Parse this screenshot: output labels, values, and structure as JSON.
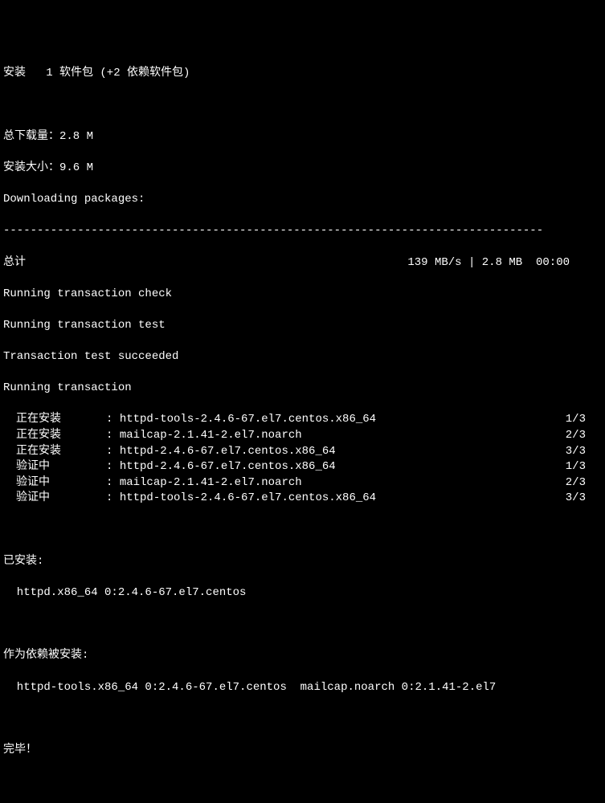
{
  "header": {
    "install_line": "安装   1 软件包 (+2 依赖软件包)"
  },
  "totals": {
    "download_size_label": "总下载量：2.8 M",
    "install_size_label": "安装大小：9.6 M",
    "downloading": "Downloading packages:",
    "separator": "--------------------------------------------------------------------------------",
    "summary_label": "总计",
    "summary_speed_size_time": "139 MB/s | 2.8 MB  00:00"
  },
  "transaction": {
    "check": "Running transaction check",
    "test": "Running transaction test",
    "succeeded": "Transaction test succeeded",
    "running": "Running transaction",
    "steps": [
      {
        "action": "正在安装",
        "colon": ": ",
        "pkg": "httpd-tools-2.4.6-67.el7.centos.x86_64",
        "count": "1/3"
      },
      {
        "action": "正在安装",
        "colon": ": ",
        "pkg": "mailcap-2.1.41-2.el7.noarch",
        "count": "2/3"
      },
      {
        "action": "正在安装",
        "colon": ": ",
        "pkg": "httpd-2.4.6-67.el7.centos.x86_64",
        "count": "3/3"
      },
      {
        "action": "验证中",
        "colon": ": ",
        "pkg": "httpd-2.4.6-67.el7.centos.x86_64",
        "count": "1/3"
      },
      {
        "action": "验证中",
        "colon": ": ",
        "pkg": "mailcap-2.1.41-2.el7.noarch",
        "count": "2/3"
      },
      {
        "action": "验证中",
        "colon": ": ",
        "pkg": "httpd-tools-2.4.6-67.el7.centos.x86_64",
        "count": "3/3"
      }
    ]
  },
  "installed": {
    "label": "已安装:",
    "pkg": "  httpd.x86_64 0:2.4.6-67.el7.centos"
  },
  "deps": {
    "label": "作为依赖被安装:",
    "pkgs": "  httpd-tools.x86_64 0:2.4.6-67.el7.centos  mailcap.noarch 0:2.1.41-2.el7"
  },
  "done": "完毕！"
}
